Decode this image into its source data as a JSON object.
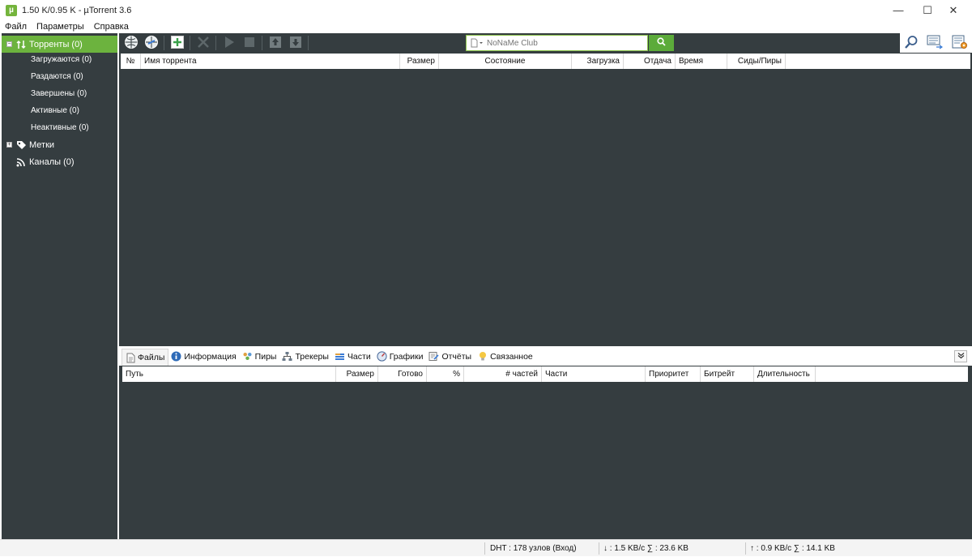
{
  "window": {
    "title": "1.50 K/0.95 K - µTorrent 3.6",
    "app_icon_glyph": "µ",
    "minimize_glyph": "—",
    "maximize_glyph": "☐",
    "close_glyph": "✕"
  },
  "menu": {
    "items": [
      {
        "label": "Файл"
      },
      {
        "label": "Параметры"
      },
      {
        "label": "Справка"
      }
    ]
  },
  "sidebar": {
    "torrents": {
      "label": "Торренты (0)",
      "expander": "−"
    },
    "sub_items": [
      {
        "label": "Загружаются (0)"
      },
      {
        "label": "Раздаются (0)"
      },
      {
        "label": "Завершены (0)"
      },
      {
        "label": "Активные (0)"
      },
      {
        "label": "Неактивные (0)"
      }
    ],
    "labels": {
      "label": "Метки",
      "expander": "+"
    },
    "feeds": {
      "label": "Каналы (0)"
    }
  },
  "toolbar": {
    "search_placeholder": "NoNaMe Club",
    "icons": [
      "add-url-icon",
      "add-rss-icon",
      "add-torrent-icon",
      "remove-icon",
      "start-icon",
      "stop-icon",
      "move-up-icon",
      "move-down-icon"
    ],
    "right_icons": [
      "search-icon",
      "remote-icon",
      "settings-icon"
    ]
  },
  "torrent_list": {
    "columns": [
      {
        "label": "№"
      },
      {
        "label": "Имя торрента"
      },
      {
        "label": "Размер"
      },
      {
        "label": "Состояние"
      },
      {
        "label": "Загрузка"
      },
      {
        "label": "Отдача"
      },
      {
        "label": "Время"
      },
      {
        "label": "Сиды/Пиры"
      }
    ],
    "rows": []
  },
  "detail_tabs": {
    "tabs": [
      {
        "label": "Файлы",
        "icon": "files-icon"
      },
      {
        "label": "Информация",
        "icon": "info-icon"
      },
      {
        "label": "Пиры",
        "icon": "peers-icon"
      },
      {
        "label": "Трекеры",
        "icon": "trackers-icon"
      },
      {
        "label": "Части",
        "icon": "pieces-icon"
      },
      {
        "label": "Графики",
        "icon": "graphs-icon"
      },
      {
        "label": "Отчёты",
        "icon": "logger-icon"
      },
      {
        "label": "Связанное",
        "icon": "related-icon"
      }
    ],
    "collapse_glyph": "»"
  },
  "files_list": {
    "columns": [
      {
        "label": "Путь"
      },
      {
        "label": "Размер"
      },
      {
        "label": "Готово"
      },
      {
        "label": "%"
      },
      {
        "label": "# частей"
      },
      {
        "label": "Части"
      },
      {
        "label": "Приоритет"
      },
      {
        "label": "Битрейт"
      },
      {
        "label": "Длительность"
      }
    ],
    "rows": []
  },
  "status": {
    "dht": "DHT : 178 узлов (Вход)",
    "download": "↓ : 1.5 KB/c  ∑ : 23.6 KB",
    "upload": "↑ : 0.9 KB/c  ∑ : 14.1 KB"
  },
  "colors": {
    "accent_green": "#6cb33e",
    "panel_dark": "#353d40"
  }
}
